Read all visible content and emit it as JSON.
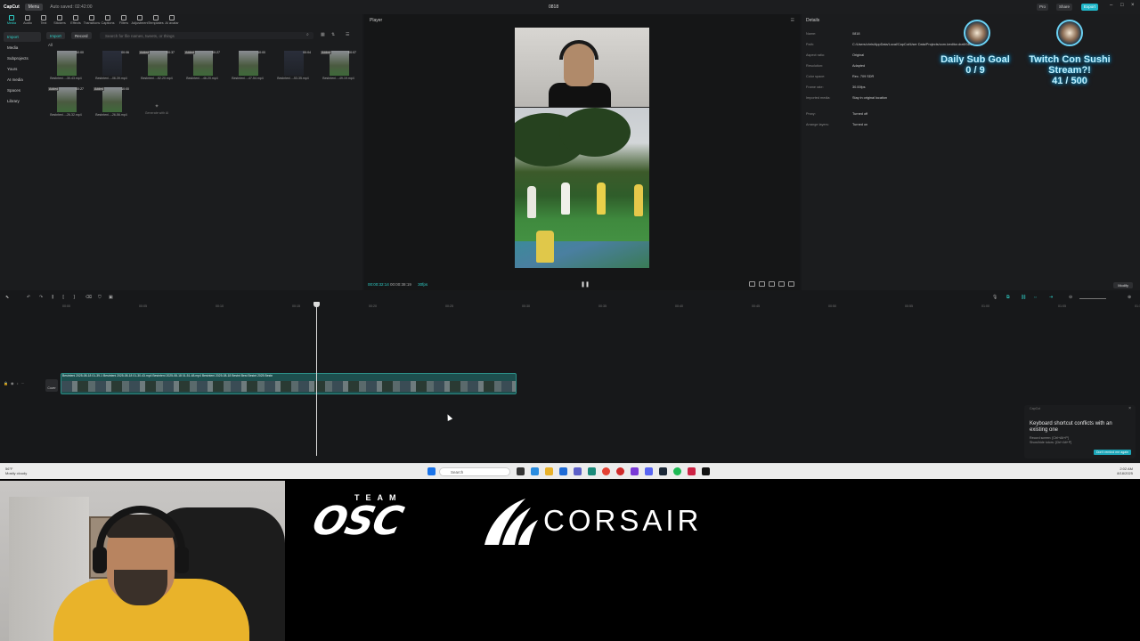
{
  "app": {
    "name": "CapCut",
    "menu_label": "Menu",
    "autosave": "Auto saved: 02:42:00",
    "project_title": "0818",
    "buttons": {
      "pro": "Pro",
      "share": "Share",
      "export": "Export"
    }
  },
  "toolbar_tabs": [
    {
      "label": "Media",
      "active": true
    },
    {
      "label": "Audio"
    },
    {
      "label": "Text"
    },
    {
      "label": "Stickers"
    },
    {
      "label": "Effects"
    },
    {
      "label": "Transitions"
    },
    {
      "label": "Captions"
    },
    {
      "label": "Filters"
    },
    {
      "label": "Adjustment"
    },
    {
      "label": "Templates"
    },
    {
      "label": "AI avatar"
    }
  ],
  "sidenav": [
    {
      "label": "Import",
      "active": true
    },
    {
      "label": "Media"
    },
    {
      "label": "Subprojects"
    },
    {
      "label": "Yours"
    },
    {
      "label": "AI media"
    },
    {
      "label": "Spaces"
    },
    {
      "label": "Library"
    }
  ],
  "media": {
    "import_label": "Import",
    "record_label": "Record",
    "search_placeholder": "Search for file names, tweets, or things",
    "all_label": "All",
    "items": [
      {
        "badge": "",
        "duration": "10:00",
        "name": "Bestnteni...-30-43.mp4"
      },
      {
        "badge": "",
        "duration": "00:06",
        "name": "Bestnteni...-06-39.mp4"
      },
      {
        "badge": "Added",
        "duration": "00:37",
        "name": "Bestnteni...-52-20.mp4"
      },
      {
        "badge": "Added",
        "duration": "00:27",
        "name": "Bestnteni...-46-20.mp4"
      },
      {
        "badge": "",
        "duration": "10:00",
        "name": "Bestnteni...-47-54.mp4"
      },
      {
        "badge": "",
        "duration": "00:04",
        "name": "Bestnteni...-53-35.mp4"
      },
      {
        "badge": "Added",
        "duration": "00:07",
        "name": "Bestnteni...-49-19.mp4"
      },
      {
        "badge": "Added",
        "duration": "00:27",
        "name": "Bestnteni...-26-32.mp4"
      },
      {
        "badge": "Added",
        "duration": "10:00",
        "name": "Bestnteni...-26-56.mp4"
      }
    ],
    "placeholder_label": "Generate with AI"
  },
  "player": {
    "title": "Player",
    "current_time": "00:00:32:14",
    "total_time": "00:00:38:19",
    "fps": "30fps"
  },
  "details": {
    "title": "Details",
    "rows": [
      {
        "k": "Name:",
        "v": "0818"
      },
      {
        "k": "Path:",
        "v": "C:/Users/chris/AppData/Local/CapCut/User Data/Projects/com.lveditor.draft/0818"
      },
      {
        "k": "Aspect ratio:",
        "v": "Original"
      },
      {
        "k": "Resolution:",
        "v": "Adapted"
      },
      {
        "k": "Color space:",
        "v": "Rec. 709 SDR"
      },
      {
        "k": "Frame rate:",
        "v": "30.00fps"
      },
      {
        "k": "Imported media:",
        "v": "Stay in original location"
      },
      {
        "k": "Proxy:",
        "v": "Turned off"
      },
      {
        "k": "Arrange layers:",
        "v": "Turned on"
      }
    ],
    "modify_label": "Modify"
  },
  "stream_goals": [
    {
      "title": "Daily Sub Goal",
      "progress": "0 / 9"
    },
    {
      "title": "Twitch Con Sushi Stream?!",
      "progress": "41 / 500"
    }
  ],
  "timeline": {
    "ruler": [
      "00:00",
      "00:05",
      "00:10",
      "00:15",
      "00:20",
      "00:25",
      "00:30",
      "00:35",
      "00:40",
      "00:45",
      "00:50",
      "00:55",
      "01:00",
      "01:05",
      "01:10"
    ],
    "cover_label": "Cover",
    "clip_labels": "Bestnteni 2025-08-18 01-39-1  Bestnteni 2025-08-18 01-30-43.mp4  Bestnteni 2025-08-18 01-51-48.mp4  Bestnteni 2025-08-18  Bestnt  Best  Bestnt 2025  Bestn"
  },
  "toast": {
    "source": "CapCut",
    "title": "Keyboard shortcut conflicts with an existing one",
    "body": "Record screen: [Ctrl+Alt+P]\nShow/hide tutors: [Ctrl+Alt+P]",
    "action": "Don't remind me again"
  },
  "taskbar": {
    "weather_temp": "56°F",
    "weather_desc": "Mostly cloudy",
    "search_placeholder": "Search",
    "time": "2:02 AM",
    "date": "8/18/2025"
  },
  "sponsors": {
    "team": "TEAM",
    "osc": "OSC",
    "corsair": "CORSAIR"
  },
  "colors": {
    "accent": "#2fd0c8",
    "track": "#1d4f4e",
    "goal_glow": "#0aa6d8"
  }
}
